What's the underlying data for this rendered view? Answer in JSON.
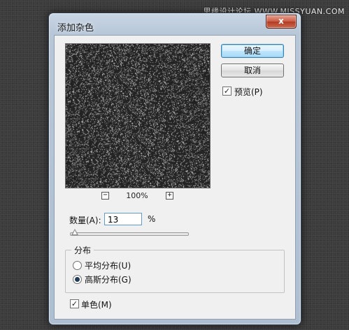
{
  "watermark": "思缘设计论坛 WWW.MISSYUAN.COM",
  "dialog": {
    "title": "添加杂色",
    "close_label": "x"
  },
  "buttons": {
    "ok": "确定",
    "cancel": "取消"
  },
  "preview_checkbox": {
    "label": "预览(P)",
    "checked": true
  },
  "zoom": {
    "minus": "−",
    "level": "100%",
    "plus": "+"
  },
  "amount": {
    "label": "数量(A):",
    "value": "13",
    "unit": "%",
    "slider_fraction": 0.033
  },
  "distribution": {
    "title": "分布",
    "options": [
      {
        "label": "平均分布(U)",
        "selected": false
      },
      {
        "label": "高斯分布(G)",
        "selected": true
      }
    ]
  },
  "monochromatic_checkbox": {
    "label": "单色(M)",
    "checked": true
  },
  "colors": {
    "noise_bg": "#3b3b3b",
    "page_bg": "#3a3a3a"
  }
}
